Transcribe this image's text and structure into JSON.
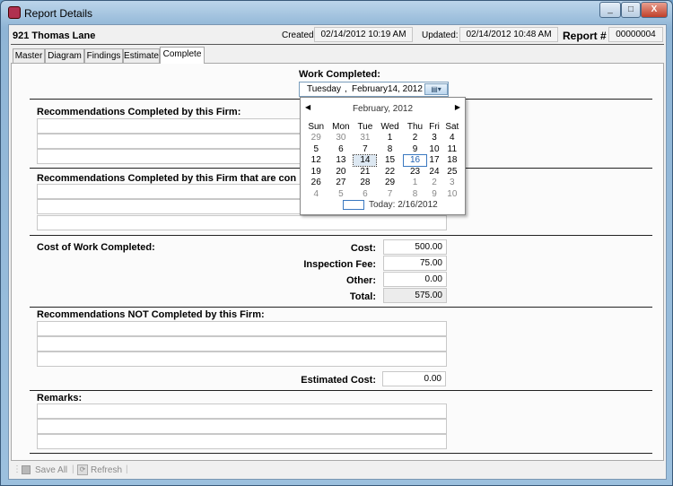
{
  "window": {
    "title": "Report Details"
  },
  "header": {
    "address": "921 Thomas Lane",
    "created_label": "Created:",
    "created": "02/14/2012 10:19 AM",
    "updated_label": "Updated:",
    "updated": "02/14/2012 10:48 AM",
    "report_label": "Report #",
    "report_no": "00000004"
  },
  "tabs": [
    {
      "label": "Master"
    },
    {
      "label": "Diagram"
    },
    {
      "label": "Findings"
    },
    {
      "label": "Estimate"
    },
    {
      "label": "Complete"
    }
  ],
  "work": {
    "label": "Work Completed:",
    "date_day": "Tuesday",
    "date_sep": ",",
    "date_month": "February",
    "date_rest": "14, 2012"
  },
  "calendar": {
    "month": "February, 2012",
    "days": [
      "Sun",
      "Mon",
      "Tue",
      "Wed",
      "Thu",
      "Fri",
      "Sat"
    ],
    "weeks": [
      [
        "29",
        "30",
        "31",
        "1",
        "2",
        "3",
        "4"
      ],
      [
        "5",
        "6",
        "7",
        "8",
        "9",
        "10",
        "11"
      ],
      [
        "12",
        "13",
        "14",
        "15",
        "16",
        "17",
        "18"
      ],
      [
        "19",
        "20",
        "21",
        "22",
        "23",
        "24",
        "25"
      ],
      [
        "26",
        "27",
        "28",
        "29",
        "1",
        "2",
        "3"
      ],
      [
        "4",
        "5",
        "6",
        "7",
        "8",
        "9",
        "10"
      ]
    ],
    "today": "Today: 2/16/2012"
  },
  "sections": {
    "rec_done": "Recommendations Completed by this Firm:",
    "rec_done_con": "Recommendations Completed by this Firm that are con",
    "cost": "Cost of Work Completed:",
    "rec_not": "Recommendations NOT Completed by this Firm:",
    "remarks": "Remarks:"
  },
  "costs": {
    "cost_label": "Cost:",
    "cost": "500.00",
    "fee_label": "Inspection Fee:",
    "fee": "75.00",
    "other_label": "Other:",
    "other": "0.00",
    "total_label": "Total:",
    "total": "575.00",
    "est_label": "Estimated Cost:",
    "est": "0.00"
  },
  "toolbar": {
    "save": "Save All",
    "refresh": "Refresh"
  }
}
